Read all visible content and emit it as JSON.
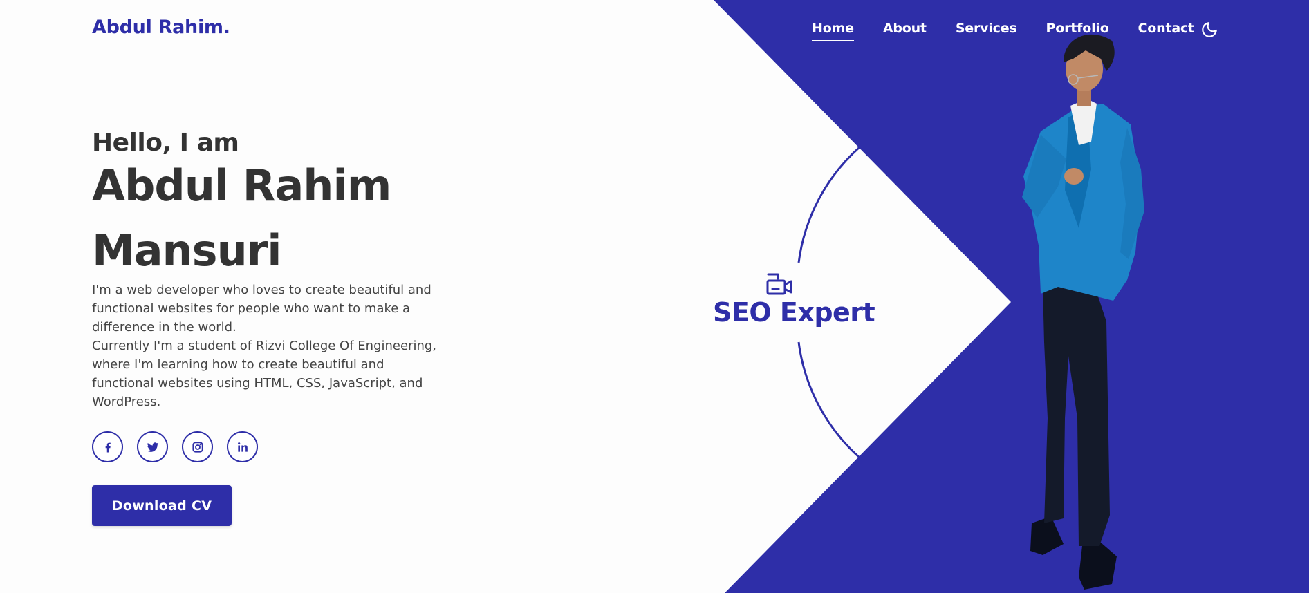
{
  "header": {
    "logo": "Abdul Rahim.",
    "nav": [
      {
        "label": "Home",
        "active": true
      },
      {
        "label": "About",
        "active": false
      },
      {
        "label": "Services",
        "active": false
      },
      {
        "label": "Portfolio",
        "active": false
      },
      {
        "label": "Contact",
        "active": false
      }
    ],
    "theme_toggle_icon": "moon-icon"
  },
  "hero": {
    "greeting": "Hello, I am",
    "name_line1": "Abdul Rahim",
    "name_line2": "Mansuri",
    "bio_p1": "I'm a web developer who loves to create beautiful and functional websites for people who want to make a difference in the world.",
    "bio_p2": "Currently I'm a student of Rizvi College Of Engineering, where I'm learning how to create beautiful and functional websites using HTML, CSS, JavaScript, and WordPress.",
    "socials": [
      {
        "icon": "facebook-icon"
      },
      {
        "icon": "twitter-icon"
      },
      {
        "icon": "instagram-icon"
      },
      {
        "icon": "linkedin-icon"
      }
    ],
    "cta_label": "Download CV"
  },
  "badge": {
    "icon": "video-camera-icon",
    "label": "SEO Expert"
  },
  "colors": {
    "accent": "#2e2ea8",
    "background": "#fdfdfd",
    "text": "#333333"
  }
}
